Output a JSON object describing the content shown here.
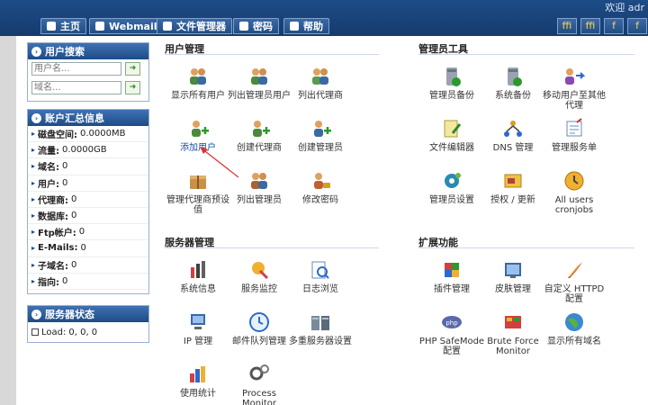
{
  "header": {
    "welcome": "欢迎 adr",
    "tabs": [
      {
        "label": "主页"
      },
      {
        "label": "Webmail"
      },
      {
        "label": "文件管理器"
      },
      {
        "label": "密码"
      },
      {
        "label": "帮助"
      }
    ],
    "right_buttons": [
      "ffi",
      "ffi",
      "f",
      "f"
    ]
  },
  "sidebar": {
    "search": {
      "title": "用户搜索",
      "user_placeholder": "用户名...",
      "domain_placeholder": "域名..."
    },
    "account": {
      "title": "账户汇总信息",
      "rows": [
        {
          "label": "磁盘空间:",
          "value": "0.0000MB"
        },
        {
          "label": "流量:",
          "value": "0.0000GB"
        },
        {
          "label": "域名:",
          "value": "0"
        },
        {
          "label": "用户:",
          "value": "0"
        },
        {
          "label": "代理商:",
          "value": "0"
        },
        {
          "label": "数据库:",
          "value": "0"
        },
        {
          "label": "Ftp帐户:",
          "value": "0"
        },
        {
          "label": "E-Mails:",
          "value": "0"
        },
        {
          "label": "子域名:",
          "value": "0"
        },
        {
          "label": "指向:",
          "value": "0"
        }
      ]
    },
    "server_status": {
      "title": "服务器状态",
      "load": "Load:",
      "load_value": "0, 0, 0"
    }
  },
  "main": {
    "user_mgmt": {
      "title": "用户管理",
      "items": [
        "显示所有用户",
        "列出管理员用户",
        "列出代理商",
        "添加用户",
        "创建代理商",
        "创建管理员",
        "管理代理商预设值",
        "列出管理员",
        "修改密码"
      ]
    },
    "admin_tools": {
      "title": "管理员工具",
      "items": [
        "管理员备份",
        "系统备份",
        "移动用户至其他代理",
        "文件编辑器",
        "DNS 管理",
        "管理服务单",
        "管理员设置",
        "授权 / 更新",
        "All users cronjobs"
      ]
    },
    "server_mgmt": {
      "title": "服务器管理",
      "items": [
        "系统信息",
        "服务监控",
        "日志浏览",
        "IP 管理",
        "邮件队列管理",
        "多重服务器设置",
        "使用统计",
        "Process Monitor"
      ]
    },
    "extensions": {
      "title": "扩展功能",
      "items": [
        "插件管理",
        "皮肤管理",
        "自定义 HTTPD 配置",
        "PHP SafeMode 配置",
        "Brute Force Monitor",
        "显示所有域名"
      ]
    }
  },
  "colors": {
    "header": "#1d4c86",
    "panel_head": "#2c5ea0",
    "arrow": "#e03030",
    "link_active": "#1a4fa3"
  }
}
